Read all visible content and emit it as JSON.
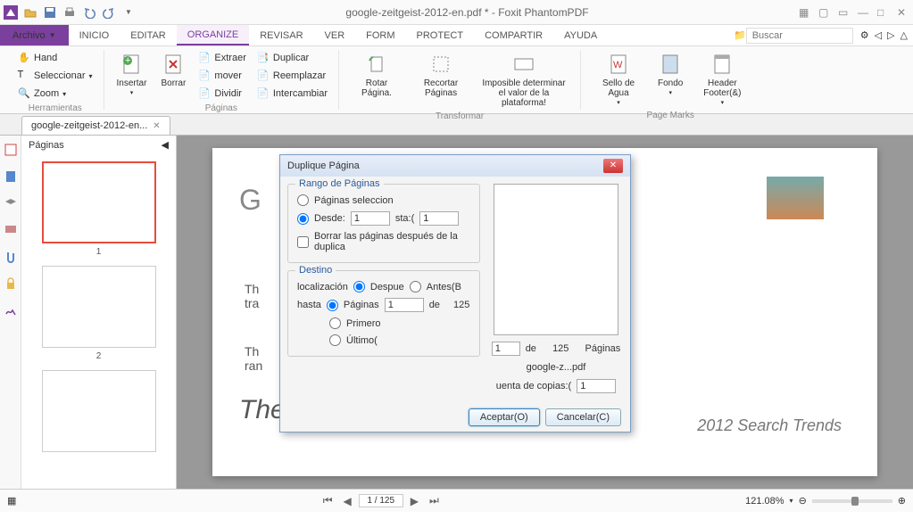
{
  "app": {
    "title": "google-zeitgeist-2012-en.pdf * - Foxit PhantomPDF"
  },
  "file_menu": {
    "label": "Archivo"
  },
  "menu_tabs": [
    "INICIO",
    "EDITAR",
    "ORGANIZE",
    "REVISAR",
    "VER",
    "FORM",
    "PROTECT",
    "COMPARTIR",
    "AYUDA"
  ],
  "active_tab_index": 2,
  "search": {
    "placeholder": "Buscar"
  },
  "ribbon": {
    "herramientas": {
      "label": "Herramientas",
      "hand": "Hand",
      "seleccionar": "Seleccionar",
      "zoom": "Zoom"
    },
    "insertar": "Insertar",
    "borrar": "Borrar",
    "paginas": {
      "label": "Páginas",
      "extraer": "Extraer",
      "mover": "mover",
      "dividir": "Dividir",
      "duplicar": "Duplicar",
      "reemplazar": "Reemplazar",
      "intercambiar": "Intercambiar"
    },
    "transformar": {
      "label": "Transformar",
      "rotar": "Rotar Página.",
      "recortar": "Recortar Páginas",
      "imposible": "Imposible determinar el valor de la plataforma!"
    },
    "pagemarks": {
      "label": "Page Marks",
      "sello": "Sello de Agua",
      "fondo": "Fondo",
      "header": "Header Footer(&)"
    }
  },
  "doc_tab": {
    "label": "google-zeitgeist-2012-en..."
  },
  "thumbs": {
    "title": "Páginas",
    "nums": [
      "1",
      "2"
    ]
  },
  "page": {
    "logo": "G",
    "heading": "The World",
    "trends": "2012 Search Trends",
    "th_txt": "Th",
    "tra_txt": "tra",
    "ran_txt": "ran"
  },
  "nav": {
    "page_input": "1 / 125"
  },
  "zoom": {
    "value": "121.08%"
  },
  "dialog": {
    "title": "Duplique Página",
    "rango": {
      "label": "Rango de Páginas",
      "sel": "Páginas seleccion",
      "desde": "Desde:",
      "desde_v": "1",
      "hasta_lbl": "sta:(",
      "hasta_v": "1",
      "borrar": "Borrar las páginas después de la duplica"
    },
    "destino": {
      "label": "Destino",
      "localizacion": "localización",
      "despues": "Despue",
      "antes": "Antes(B",
      "hasta": "hasta",
      "paginas": "Páginas",
      "pag_v": "1",
      "de": "de",
      "total": "125",
      "primero": "Primero",
      "ultimo": "Último("
    },
    "preview": {
      "de": "de",
      "total": "125",
      "paginas": "Páginas",
      "file": "google-z...pdf",
      "copias": "uenta de copias:(",
      "copias_v": "1",
      "page_v": "1"
    },
    "ok": "Aceptar(O)",
    "cancel": "Cancelar(C)"
  }
}
